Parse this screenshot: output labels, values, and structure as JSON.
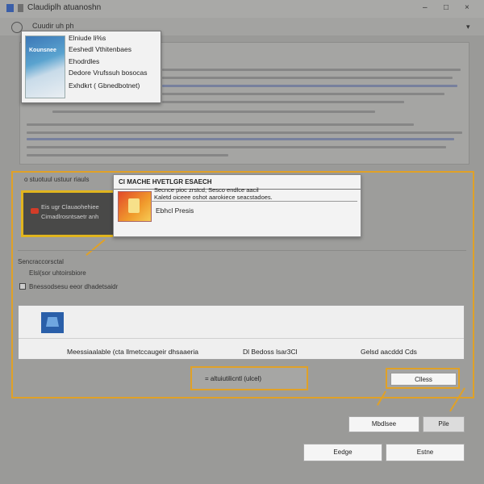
{
  "window": {
    "title": "Claudiplh atuanoshn",
    "toolbar_text": "Cuudir uh ph"
  },
  "menu_popup": {
    "icon_text": "Kounsnee",
    "items": [
      "Elniude li%s",
      "Eeshedl Vthitenbaes",
      "Ehodrdles",
      "Dedore Vrufssuh bosocas",
      "Exhdkrt ( Gbnedbotnet)"
    ]
  },
  "panel": {
    "section_label": "o stuotuul ustuur riauls",
    "dark_card_text": [
      "Eis ugr Clauaohehiee",
      "Cimadlrosntsaetr anh"
    ]
  },
  "file_popup": {
    "header": "Cl MACHE HVETLGR ESAECH",
    "line1": "Secnce pioc zrstcd, Sesco endlce aacil",
    "line2": "Kaletd oiceee oshot aarokiece seacstadoes.",
    "line3": "Ebhcl Presis"
  },
  "labels": {
    "settings_label": "Sencraccorsctal",
    "sub_label": "Elsl(sor uhtoirsbiore",
    "path_label": "Bnessodsesu eeor dhadetsaidr"
  },
  "white_bar": {
    "label_left": "Meessiaalable (cta llmetccaugeir dhsaaeria",
    "label_mid": "Dl Bedoss lsar3Cl",
    "label_right": "Gelsd aacddd Cds"
  },
  "input": {
    "value": "= altuiutilicntl (ulcel)"
  },
  "buttons": {
    "orange_button": "Clless",
    "mid_left": "Mbdlsee",
    "mid_right": "Pile",
    "bottom_left": "Eedge",
    "bottom_right": "Estne"
  },
  "colors": {
    "highlight": "#e0a127",
    "yellow_frame": "#e1b51e",
    "accent_blue": "#2a5fa9"
  }
}
